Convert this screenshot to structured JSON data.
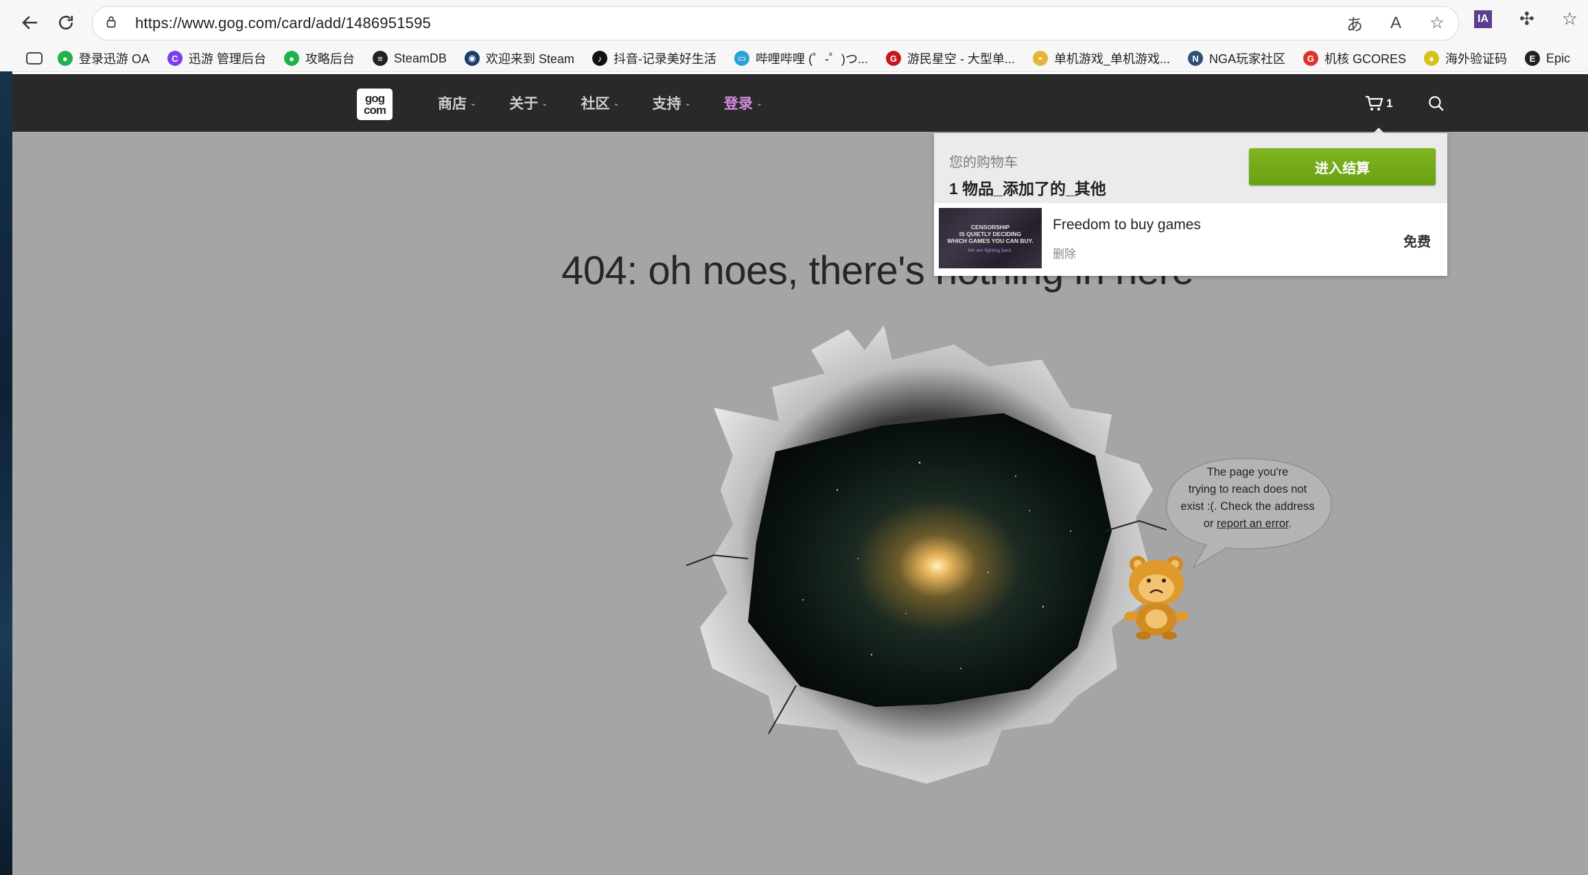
{
  "browser": {
    "url": "https://www.gog.com/card/add/1486951595",
    "bookmarks": [
      {
        "label": "登录迅游 OA",
        "color": "#1fb24a",
        "glyph": "●"
      },
      {
        "label": "迅游 管理后台",
        "color": "#7a3ff0",
        "glyph": "C"
      },
      {
        "label": "攻略后台",
        "color": "#1fb24a",
        "glyph": "●"
      },
      {
        "label": "SteamDB",
        "color": "#222222",
        "glyph": "≡"
      },
      {
        "label": "欢迎来到 Steam",
        "color": "#1b3b6b",
        "glyph": "◉"
      },
      {
        "label": "抖音-记录美好生活",
        "color": "#111111",
        "glyph": "♪"
      },
      {
        "label": "哔哩哔哩 (゜-゜)つ...",
        "color": "#2aa1d8",
        "glyph": "▭"
      },
      {
        "label": "游民星空 - 大型单...",
        "color": "#c8161d",
        "glyph": "G"
      },
      {
        "label": "单机游戏_单机游戏...",
        "color": "#e7b33b",
        "glyph": "◓"
      },
      {
        "label": "NGA玩家社区",
        "color": "#2f4f7a",
        "glyph": "N"
      },
      {
        "label": "机核 GCORES",
        "color": "#e0322b",
        "glyph": "G"
      },
      {
        "label": "海外验证码",
        "color": "#d8c21a",
        "glyph": "●"
      },
      {
        "label": "Epic",
        "color": "#222222",
        "glyph": "E"
      }
    ]
  },
  "gog": {
    "logo_top": "gog",
    "logo_bottom": "com",
    "menu": [
      {
        "label": "商店"
      },
      {
        "label": "关于"
      },
      {
        "label": "社区"
      },
      {
        "label": "支持"
      },
      {
        "label": "登录"
      }
    ],
    "cart_count": "1"
  },
  "cart": {
    "title": "您的购物车",
    "subtitle": "1 物品_添加了的_其他",
    "checkout_label": "进入结算",
    "item": {
      "name": "Freedom to buy games",
      "remove_label": "删除",
      "price": "免费",
      "thumb_line1": "CENSORSHIP",
      "thumb_line2": "IS QUIETLY DECIDING",
      "thumb_line3": "WHICH GAMES YOU CAN BUY.",
      "thumb_line4": "We are fighting back."
    }
  },
  "error": {
    "headline": "404: oh noes, there's nothing in here",
    "bubble_line1": "The page you're",
    "bubble_line2": "trying to reach does not",
    "bubble_line3": "exist :(. Check the address",
    "bubble_line4_prefix": "or ",
    "bubble_link": "report an error",
    "bubble_line4_suffix": "."
  }
}
